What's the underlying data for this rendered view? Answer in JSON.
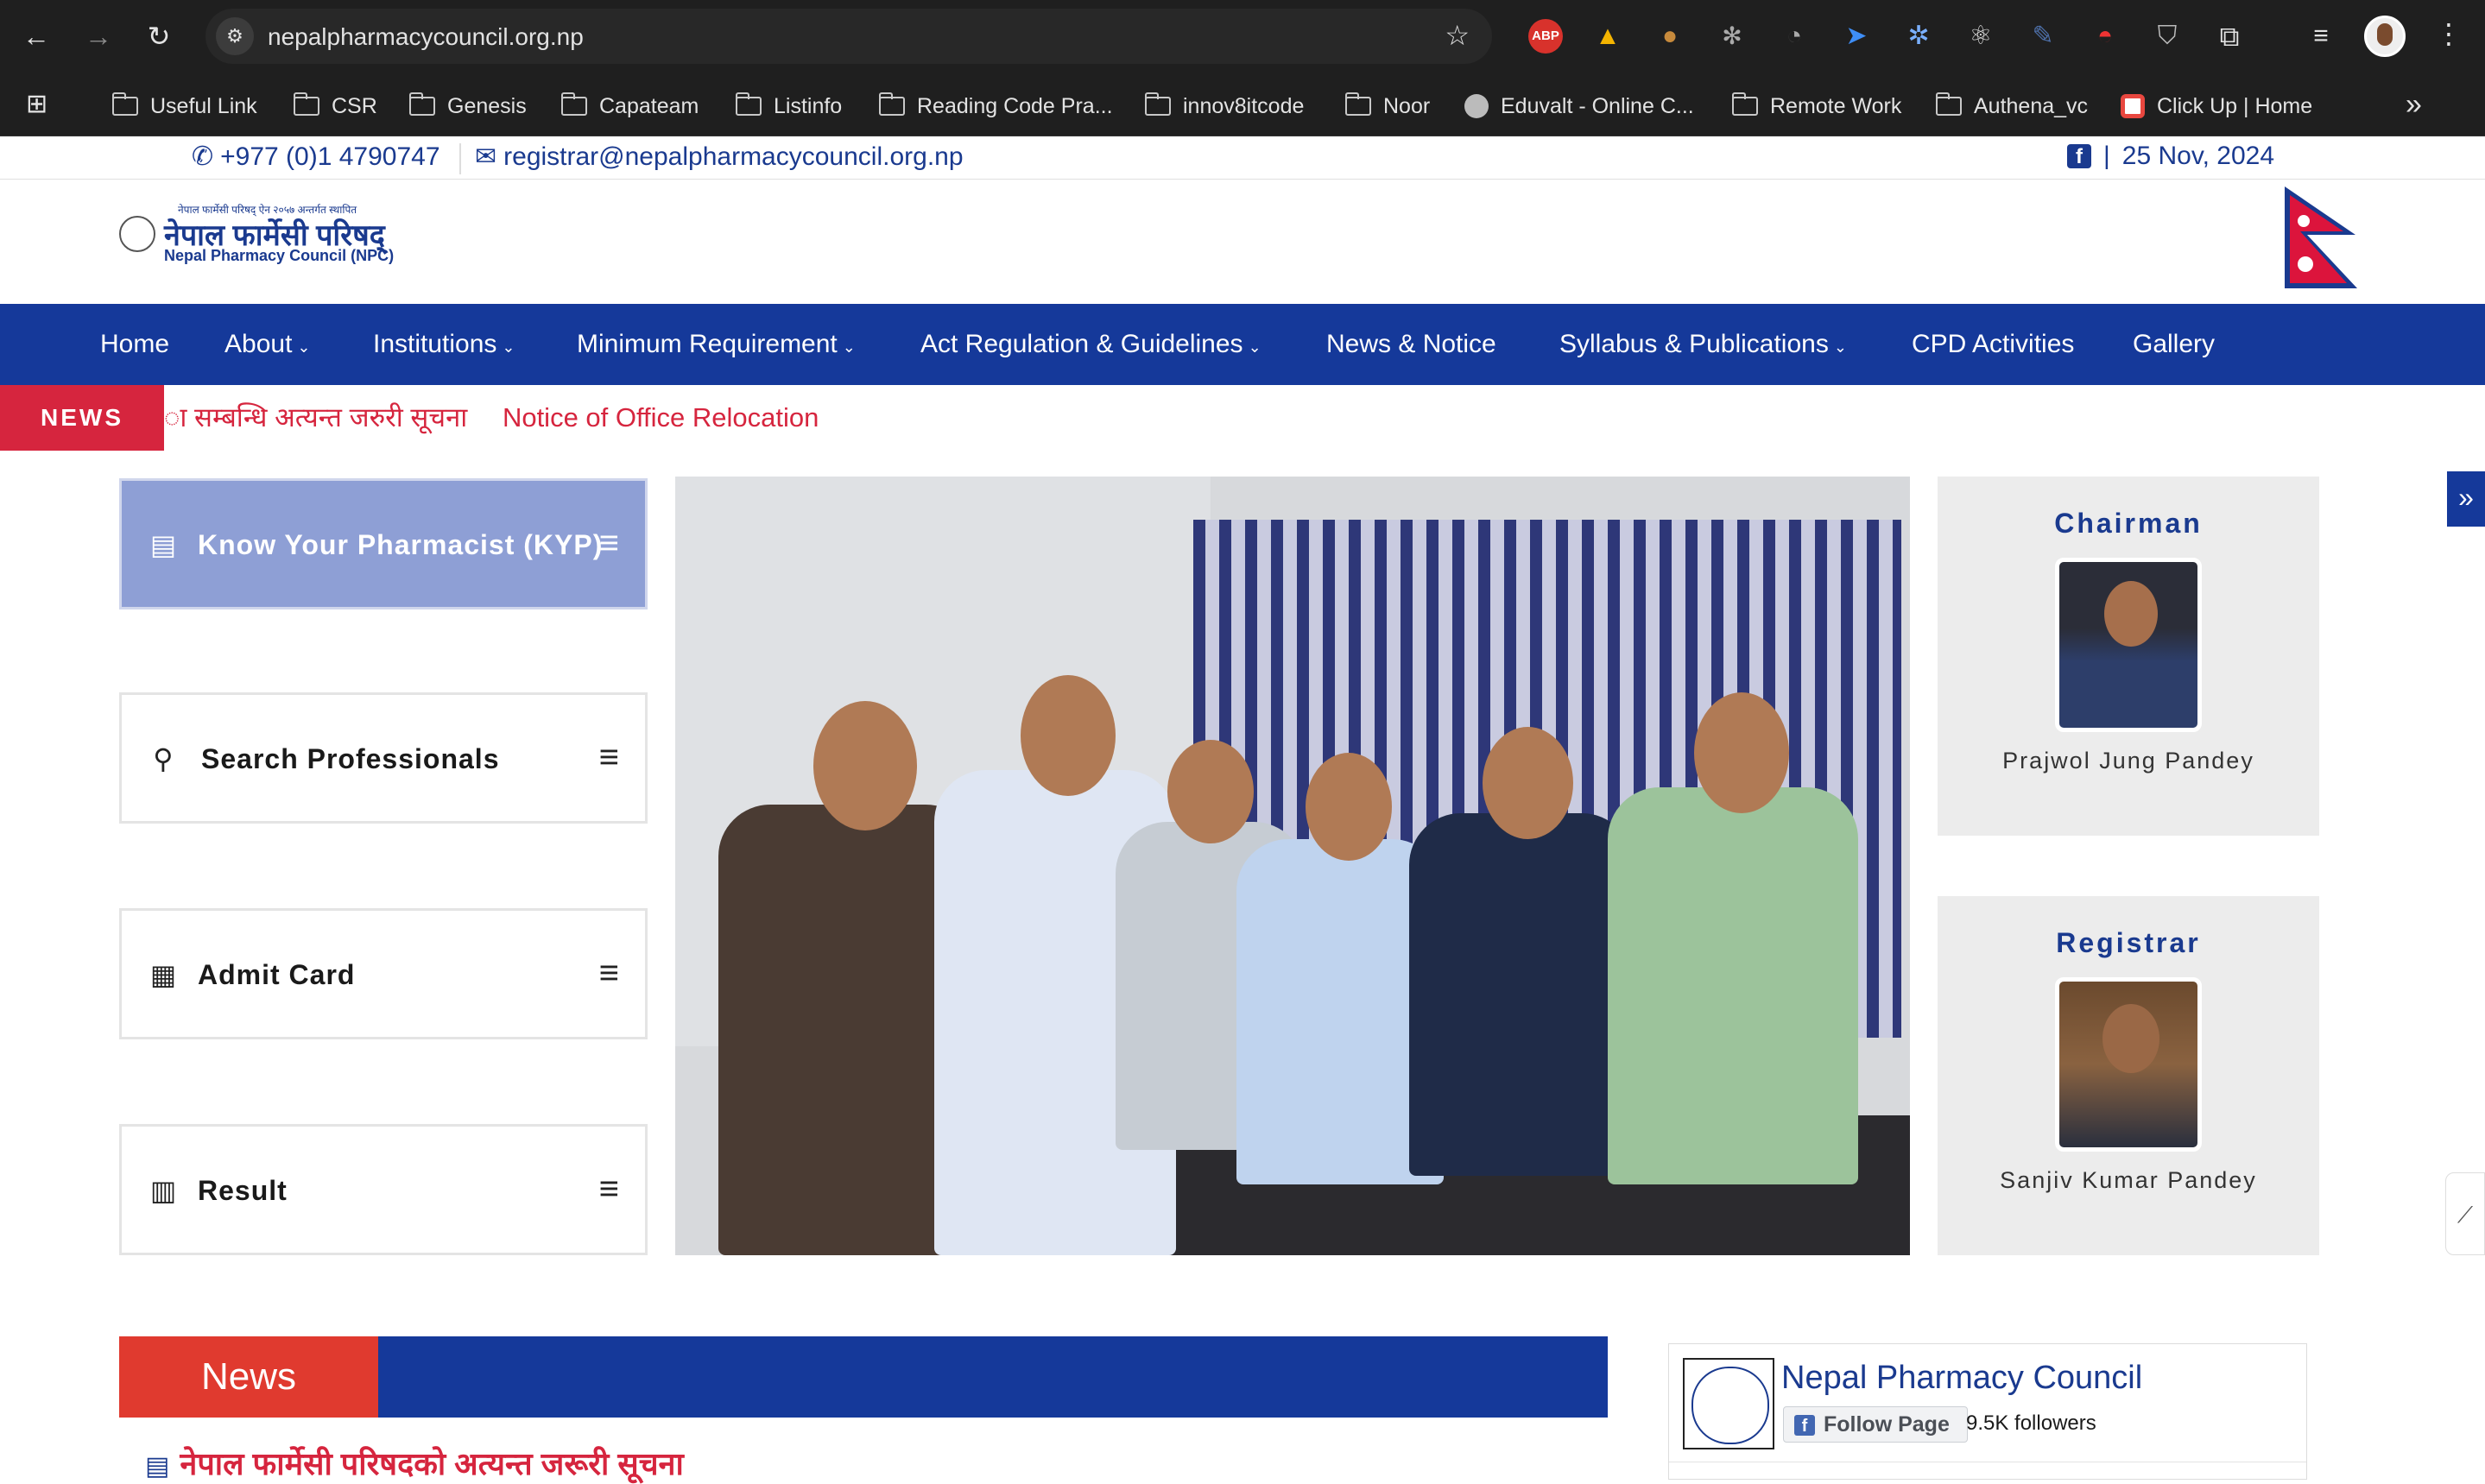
{
  "browser": {
    "url": "nepalpharmacycouncil.org.np",
    "bookmarks": [
      "Useful Link",
      "CSR",
      "Genesis",
      "Capateam",
      "Listinfo",
      "Reading Code Pra...",
      "innov8itcode",
      "Noor",
      "Eduvalt - Online C...",
      "Remote Work",
      "Authena_vc",
      "Click Up | Home"
    ],
    "extension_abp": "ABP"
  },
  "topbar": {
    "phone": "+977 (0)1 4790747",
    "email": "registrar@nepalpharmacycouncil.org.np",
    "date": "25 Nov, 2024",
    "date_sep": "|"
  },
  "logo": {
    "small_line": "नेपाल फार्मेसी परिषद् ऐन २०५७ अन्तर्गत स्थापित",
    "nepali_name": "नेपाल फार्मेसी परिषद्",
    "english_name": "Nepal Pharmacy Council (NPC)"
  },
  "nav": [
    "Home",
    "About",
    "Institutions",
    "Minimum Requirement",
    "Act Regulation & Guidelines",
    "News & Notice",
    "Syllabus & Publications",
    "CPD Activities",
    "Gallery"
  ],
  "news_ticker": {
    "label": "NEWS",
    "items": [
      "ा सम्बन्धि अत्यन्त जरुरी सूचना",
      "Notice of Office Relocation"
    ]
  },
  "quick_links": [
    "Know Your Pharmacist (KYP)",
    "Search Professionals",
    "Admit Card",
    "Result"
  ],
  "officials": [
    {
      "title": "Chairman",
      "name": "Prajwol Jung Pandey"
    },
    {
      "title": "Registrar",
      "name": "Sanjiv Kumar Pandey"
    }
  ],
  "news_section": {
    "heading": "News",
    "first_item": "नेपाल फार्मेसी परिषदको अत्यन्त जरूरी सूचना"
  },
  "facebook": {
    "page_name": "Nepal Pharmacy Council",
    "follow_label": "Follow Page",
    "followers": "9.5K followers"
  },
  "colors": {
    "primary": "#15399a",
    "accent_red": "#d6253e",
    "kyp_card": "#8e9fd5"
  }
}
